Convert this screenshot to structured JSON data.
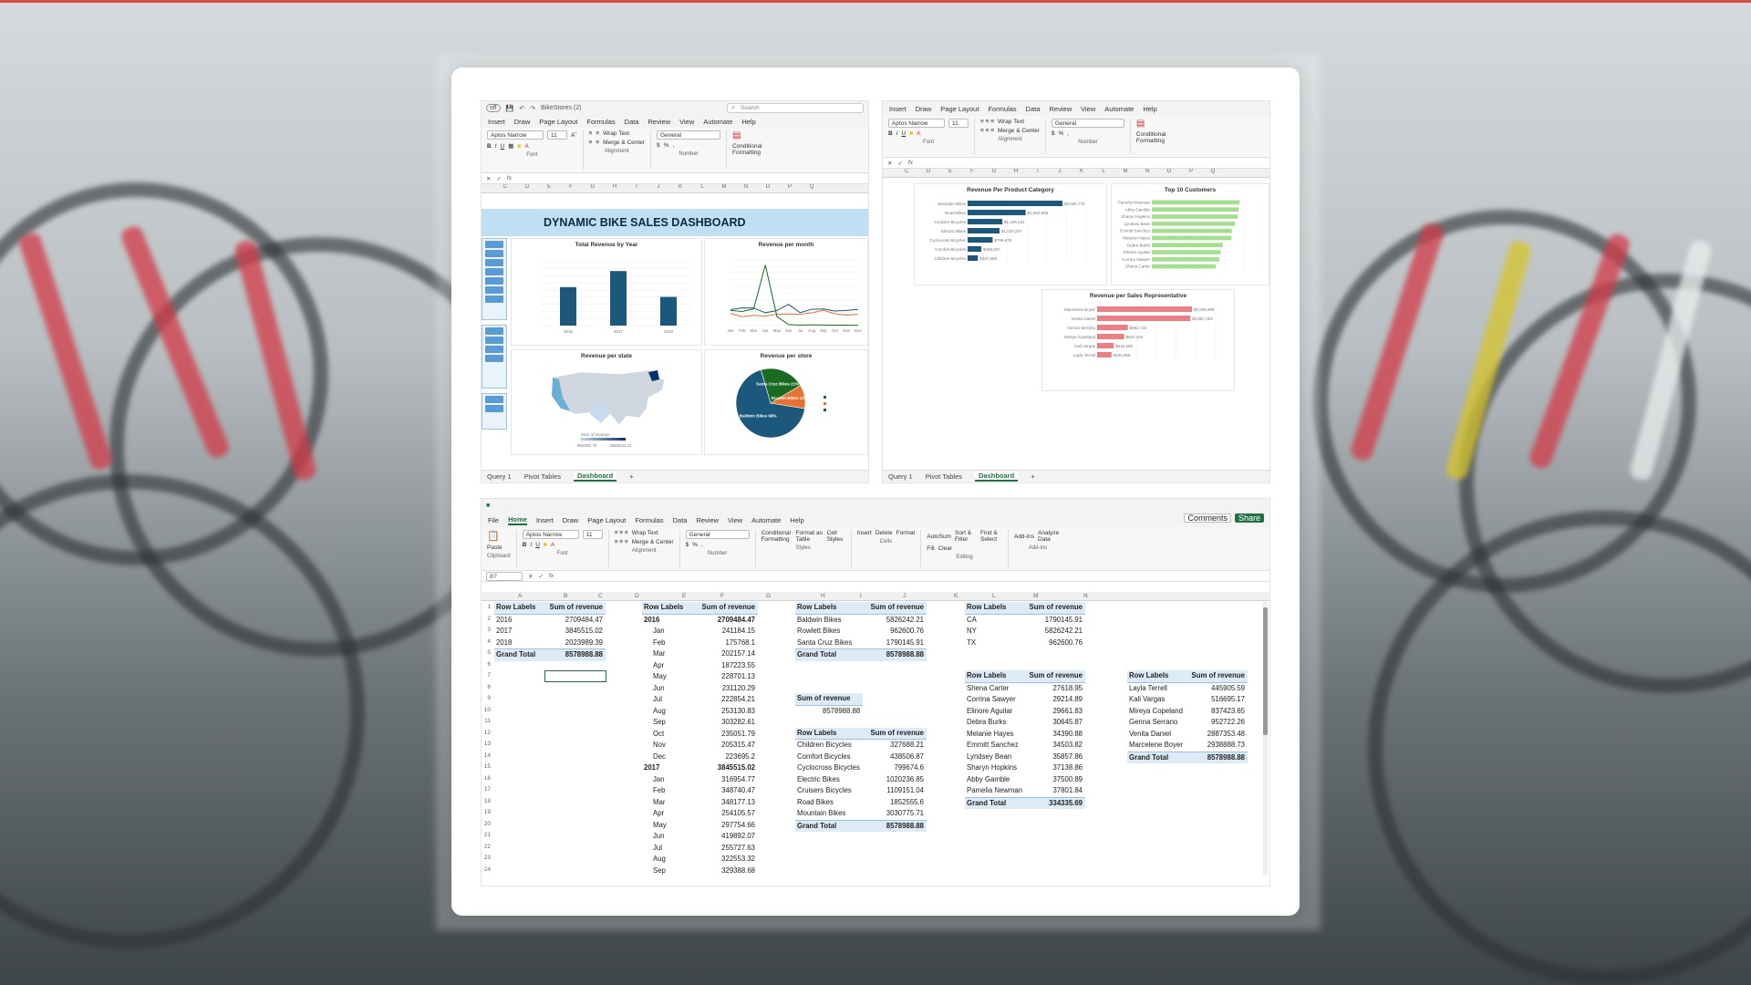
{
  "top_left": {
    "qat_title": "BikeStores (2)",
    "search": "Search",
    "menu": [
      "Insert",
      "Draw",
      "Page Layout",
      "Formulas",
      "Data",
      "Review",
      "View",
      "Automate",
      "Help"
    ],
    "font_name": "Aptos Narrow",
    "font_size": "11",
    "number_format": "General",
    "wrap_text": "Wrap Text",
    "merge_center": "Merge & Center",
    "cond_format": "Conditional Formatting",
    "group_labels": [
      "Font",
      "Alignment",
      "Number"
    ],
    "fx": "fx",
    "columns": [
      "C",
      "D",
      "E",
      "F",
      "G",
      "H",
      "I",
      "J",
      "K",
      "L",
      "M",
      "N",
      "O",
      "P",
      "Q"
    ],
    "dashboard_title": "DYNAMIC BIKE SALES DASHBOARD",
    "charts": {
      "revenue_by_year": {
        "title": "Total Revenue by Year"
      },
      "revenue_per_month": {
        "title": "Revenue per month"
      },
      "revenue_per_state": {
        "title": "Revenue per state",
        "legend_label": "Sum of revenue",
        "legend_min": "962600.76",
        "legend_max": "5826242.21"
      },
      "revenue_per_store": {
        "title": "Revenue per store",
        "slices": [
          "Santa Cruz Bikes 21%",
          "Rowlett Bikes 11%",
          "Baldwin Bikes 68%"
        ]
      }
    },
    "tabs": [
      "Query 1",
      "Pivot Tables",
      "Dashboard"
    ]
  },
  "top_right": {
    "menu": [
      "Insert",
      "Draw",
      "Page Layout",
      "Formulas",
      "Data",
      "Review",
      "View",
      "Automate",
      "Help"
    ],
    "font_name": "Aptos Narrow",
    "font_size": "11",
    "number_format": "General",
    "wrap_text": "Wrap Text",
    "merge_center": "Merge & Center",
    "cond_format": "Conditional Formatting",
    "group_labels": [
      "Font",
      "Alignment",
      "Number"
    ],
    "fx": "fx",
    "columns": [
      "C",
      "D",
      "E",
      "F",
      "G",
      "H",
      "I",
      "J",
      "K",
      "L",
      "M",
      "N",
      "O",
      "P",
      "Q"
    ],
    "charts": {
      "per_category": {
        "title": "Revenue Per Product Category",
        "labels": [
          "$3,030,776",
          "$1,852,556",
          "$1,109,151",
          "$1,020,237",
          "$799,675",
          "$438,507",
          "$327,689"
        ]
      },
      "top_customers": {
        "title": "Top 10 Customers"
      },
      "per_rep": {
        "title": "Revenue per Sales Representative",
        "labels": [
          "$2,938,689",
          "$2,887,353",
          "$952,722",
          "$837,424",
          "$516,695",
          "$445,906"
        ]
      }
    },
    "tabs": [
      "Query 1",
      "Pivot Tables",
      "Dashboard"
    ]
  },
  "bottom": {
    "menu": [
      "File",
      "Home",
      "Insert",
      "Draw",
      "Page Layout",
      "Formulas",
      "Data",
      "Review",
      "View",
      "Automate",
      "Help"
    ],
    "comments": "Comments",
    "share": "Share",
    "font_name": "Aptos Narrow",
    "font_size": "11",
    "number_format": "General",
    "wrap_text": "Wrap Text",
    "merge_center": "Merge & Center",
    "autosum": "AutoSum",
    "fill": "Fill",
    "clear": "Clear",
    "ribbon_buttons": [
      "Paste",
      "Conditional Formatting",
      "Format as Table",
      "Cell Styles",
      "Insert",
      "Delete",
      "Format",
      "Sort & Filter",
      "Find & Select",
      "Add-ins",
      "Analyze Data"
    ],
    "group_labels": [
      "Clipboard",
      "Font",
      "Alignment",
      "Number",
      "Styles",
      "Cells",
      "Editing",
      "Add-ins"
    ],
    "cell_ref": "B7",
    "fx": "fx",
    "columns": [
      "A",
      "B",
      "C",
      "D",
      "E",
      "F",
      "G",
      "H",
      "I",
      "J",
      "K",
      "L",
      "M",
      "N"
    ],
    "row_numbers": [
      "1",
      "2",
      "3",
      "4",
      "5",
      "6",
      "7",
      "8",
      "9",
      "10",
      "11",
      "12",
      "13",
      "14",
      "15",
      "16",
      "17",
      "18",
      "19",
      "20",
      "21",
      "22",
      "23",
      "24"
    ],
    "pivot_year": {
      "h1": "Row Labels",
      "h2": "Sum of revenue",
      "rows": [
        [
          "2016",
          "2709484.47"
        ],
        [
          "2017",
          "3845515.02"
        ],
        [
          "2018",
          "2023989.39"
        ]
      ],
      "total": [
        "Grand Total",
        "8578988.88"
      ]
    },
    "pivot_month": {
      "h1": "Row Labels",
      "h2": "Sum of revenue",
      "rows": [
        [
          "2016",
          "2709484.47"
        ],
        [
          "Jan",
          "241184.15"
        ],
        [
          "Feb",
          "175768.1"
        ],
        [
          "Mar",
          "202157.14"
        ],
        [
          "Apr",
          "187223.55"
        ],
        [
          "May",
          "228701.13"
        ],
        [
          "Jun",
          "231120.29"
        ],
        [
          "Jul",
          "222854.21"
        ],
        [
          "Aug",
          "253130.83"
        ],
        [
          "Sep",
          "303282.61"
        ],
        [
          "Oct",
          "235051.79"
        ],
        [
          "Nov",
          "205315.47"
        ],
        [
          "Dec",
          "223695.2"
        ],
        [
          "2017",
          "3845515.02"
        ],
        [
          "Jan",
          "316954.77"
        ],
        [
          "Feb",
          "348740.47"
        ],
        [
          "Mar",
          "348177.13"
        ],
        [
          "Apr",
          "254105.57"
        ],
        [
          "May",
          "297754.66"
        ],
        [
          "Jun",
          "419892.07"
        ],
        [
          "Jul",
          "255727.63"
        ],
        [
          "Aug",
          "322553.32"
        ],
        [
          "Sep",
          "329388.68"
        ]
      ]
    },
    "pivot_store": {
      "h1": "Row Labels",
      "h2": "Sum of revenue",
      "rows": [
        [
          "Baldwin Bikes",
          "5826242.21"
        ],
        [
          "Rowlett Bikes",
          "962600.76"
        ],
        [
          "Santa Cruz Bikes",
          "1790145.91"
        ]
      ],
      "total": [
        "Grand Total",
        "8578988.88"
      ]
    },
    "sum_box": {
      "label": "Sum of revenue",
      "value": "8578988.88"
    },
    "pivot_category": {
      "h1": "Row Labels",
      "h2": "Sum of revenue",
      "rows": [
        [
          "Children Bicycles",
          "327688.21"
        ],
        [
          "Comfort Bicycles",
          "438506.87"
        ],
        [
          "Cyclocross Bicycles",
          "799674.6"
        ],
        [
          "Electric Bikes",
          "1020236.85"
        ],
        [
          "Cruisers Bicycles",
          "1109151.04"
        ],
        [
          "Road Bikes",
          "1852555.6"
        ],
        [
          "Mountain Bikes",
          "3030775.71"
        ]
      ],
      "total": [
        "Grand Total",
        "8578988.88"
      ]
    },
    "pivot_state": {
      "h1": "Row Labels",
      "h2": "Sum of revenue",
      "rows": [
        [
          "CA",
          "1790145.91"
        ],
        [
          "NY",
          "5826242.21"
        ],
        [
          "TX",
          "962600.76"
        ]
      ]
    },
    "pivot_customer": {
      "h1": "Row Labels",
      "h2": "Sum of revenue",
      "rows": [
        [
          "Shena Carter",
          "27618.95"
        ],
        [
          "Corrina Sawyer",
          "29214.89"
        ],
        [
          "Elinore Aguilar",
          "29661.83"
        ],
        [
          "Debra Burks",
          "30645.87"
        ],
        [
          "Melanie Hayes",
          "34390.88"
        ],
        [
          "Emmitt Sanchez",
          "34503.82"
        ],
        [
          "Lyndsey Bean",
          "35857.86"
        ],
        [
          "Sharyn Hopkins",
          "37138.86"
        ],
        [
          "Abby Gamble",
          "37500.89"
        ],
        [
          "Pamelia Newman",
          "37801.84"
        ]
      ],
      "total": [
        "Grand Total",
        "334335.69"
      ]
    },
    "pivot_rep": {
      "h1": "Row Labels",
      "h2": "Sum of revenue",
      "rows": [
        [
          "Layla Terrell",
          "445905.59"
        ],
        [
          "Kali Vargas",
          "516695.17"
        ],
        [
          "Mireya Copeland",
          "837423.65"
        ],
        [
          "Genna Serrano",
          "952722.26"
        ],
        [
          "Venita Daniel",
          "2887353.48"
        ],
        [
          "Marcelene Boyer",
          "2938888.73"
        ]
      ],
      "total": [
        "Grand Total",
        "8578988.88"
      ]
    }
  },
  "chart_data": [
    {
      "type": "bar",
      "title": "Total Revenue by Year",
      "categories": [
        "2016",
        "2017",
        "2018"
      ],
      "values": [
        2709484.47,
        3845515.02,
        2023989.39
      ],
      "ylim": [
        0,
        4500000
      ]
    },
    {
      "type": "line",
      "title": "Revenue per month",
      "x": [
        "Jan",
        "Feb",
        "Mar",
        "Apr",
        "May",
        "Jun",
        "Jul",
        "Aug",
        "Sep",
        "Oct",
        "Nov",
        "Dec"
      ],
      "series": [
        {
          "values": [
            241184,
            175768,
            202157,
            187224,
            228701,
            231120,
            222854,
            253131,
            303283,
            235052,
            205315,
            223695
          ]
        },
        {
          "values": [
            316955,
            348740,
            348177,
            254106,
            297755,
            419892,
            255728,
            322553,
            329389,
            290000,
            300000,
            320000
          ]
        },
        {
          "values": [
            300000,
            280000,
            330000,
            1200000,
            180000,
            20000,
            10000,
            15000,
            12000,
            10000,
            8000,
            5000
          ]
        }
      ]
    },
    {
      "type": "pie",
      "title": "Revenue per store",
      "categories": [
        "Baldwin Bikes",
        "Santa Cruz Bikes",
        "Rowlett Bikes"
      ],
      "values": [
        68,
        21,
        11
      ]
    },
    {
      "type": "bar",
      "title": "Revenue Per Product Category",
      "categories": [
        "Mountain Bikes",
        "Road Bikes",
        "Cruisers Bicycles",
        "Electric Bikes",
        "Cyclocross Bicycles",
        "Comfort Bicycles",
        "Children Bicycles"
      ],
      "values": [
        3030776,
        1852556,
        1109151,
        1020237,
        799675,
        438507,
        327689
      ]
    },
    {
      "type": "bar",
      "title": "Top 10 Customers",
      "categories": [
        "Pamelia Newman",
        "Abby Gamble",
        "Sharyn Hopkins",
        "Lyndsey Bean",
        "Emmitt Sanchez",
        "Melanie Hayes",
        "Debra Burks",
        "Elinore Aguilar",
        "Corrina Sawyer",
        "Shena Carter"
      ],
      "values": [
        37801.84,
        37500.89,
        37138.86,
        35857.86,
        34503.82,
        34390.88,
        30645.87,
        29661.83,
        29214.89,
        27618.95
      ]
    },
    {
      "type": "bar",
      "title": "Revenue per Sales Representative",
      "categories": [
        "Marcelene Boyer",
        "Venita Daniel",
        "Genna Serrano",
        "Mireya Copeland",
        "Kali Vargas",
        "Layla Terrell"
      ],
      "values": [
        2938689,
        2887353,
        952722,
        837424,
        516695,
        445906
      ]
    }
  ]
}
